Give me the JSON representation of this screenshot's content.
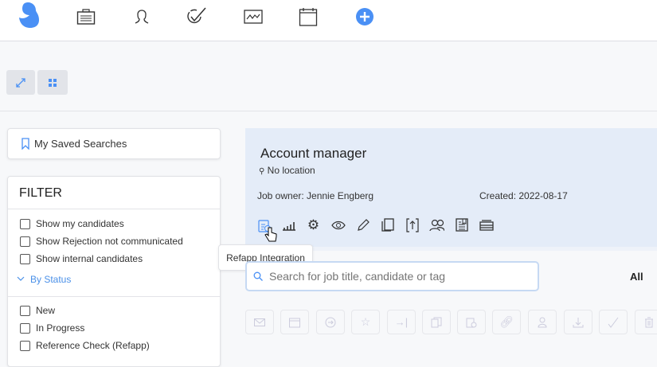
{
  "nav": {
    "items": [
      "logo",
      "briefcase-icon",
      "person-icon",
      "checkmark-icon",
      "chart-icon",
      "calendar-icon",
      "add-icon"
    ],
    "accent": "#4a90f5"
  },
  "toolbar": {
    "expand": "expand-icon",
    "grid": "grid-icon"
  },
  "saved_searches": {
    "label": "My Saved Searches"
  },
  "filter": {
    "title": "FILTER",
    "options": [
      "Show my candidates",
      "Show Rejection not communicated",
      "Show internal candidates"
    ],
    "status_header": "By Status",
    "statuses": [
      "New",
      "In Progress",
      "Reference Check (Refapp)"
    ]
  },
  "job": {
    "title": "Account manager",
    "location": "No location",
    "owner": "Job owner: Jennie Engberg",
    "created": "Created: 2022-08-17",
    "actions": [
      "refapp-integration",
      "stats",
      "settings",
      "view",
      "edit",
      "copy",
      "export",
      "team",
      "document",
      "archive"
    ]
  },
  "tooltip": "Refapp Integration",
  "search": {
    "placeholder": "Search for job title, candidate or tag",
    "value": ""
  },
  "filter_all": "All",
  "bulk_actions": [
    "email",
    "calendar",
    "move",
    "star",
    "assign",
    "copy",
    "refapp",
    "link",
    "person",
    "download",
    "check",
    "delete"
  ]
}
